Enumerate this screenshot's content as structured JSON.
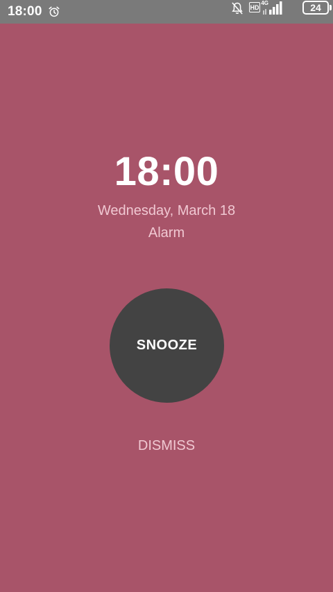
{
  "status_bar": {
    "time": "18:00",
    "icons": [
      "alarm-clock-icon",
      "bell-off-icon",
      "hd-icon",
      "signal-icon",
      "battery-icon"
    ],
    "hd_label": "HD",
    "network_label": "4G",
    "battery_level": "24"
  },
  "alarm": {
    "time": "18:00",
    "date": "Wednesday, March 18",
    "label": "Alarm"
  },
  "actions": {
    "snooze_label": "SNOOZE",
    "dismiss_label": "DISMISS"
  },
  "colors": {
    "background": "#a85469",
    "status_bar": "#7a7a7a",
    "snooze_button": "#434343",
    "secondary_text": "#f0c8d2"
  }
}
